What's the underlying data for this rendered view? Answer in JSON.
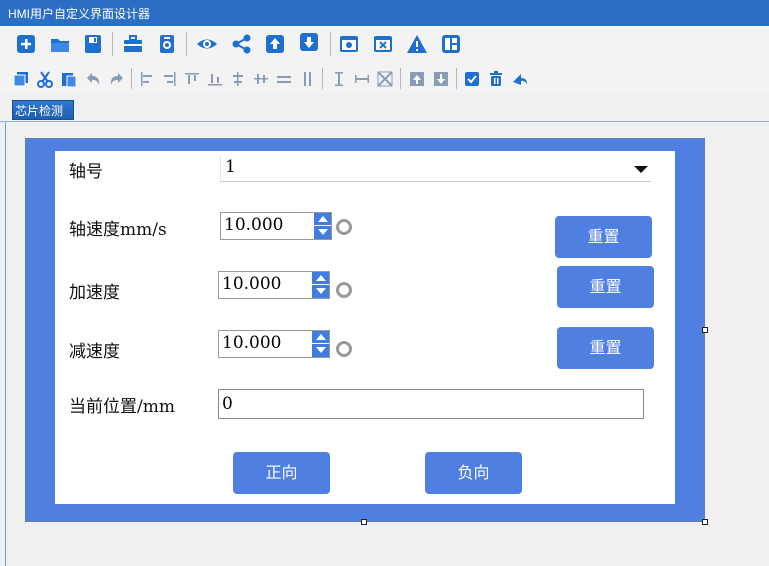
{
  "window": {
    "title": "HMI用户自定义界面设计器"
  },
  "toolbar1": {
    "icons": [
      "new-icon",
      "open-folder-icon",
      "save-icon",
      "toolbox-icon",
      "properties-icon",
      "preview-eye-icon",
      "share-icon",
      "upload-icon",
      "download-icon",
      "window-settings-icon",
      "window-close-icon",
      "warning-icon",
      "layout-icon"
    ]
  },
  "toolbar2": {
    "icons": [
      "copy-icon",
      "cut-icon",
      "paste-icon",
      "undo-icon",
      "redo-icon",
      "align-left-icon",
      "align-right-icon",
      "align-top-icon",
      "align-bottom-icon",
      "align-center-h-icon",
      "align-center-v-icon",
      "distribute-h-icon",
      "distribute-v-icon",
      "same-height-icon",
      "same-width-icon",
      "same-size-icon",
      "bring-front-icon",
      "send-back-icon",
      "check-icon",
      "delete-icon",
      "export-icon"
    ]
  },
  "tabs": [
    {
      "label": "芯片检测",
      "active": true
    }
  ],
  "form": {
    "axis": {
      "label": "轴号",
      "value": "1"
    },
    "axis_speed": {
      "label": "轴速度mm/s",
      "value": "10.000",
      "reset": "重置"
    },
    "acceleration": {
      "label": "加速度",
      "value": "10.000",
      "reset": "重置"
    },
    "deceleration": {
      "label": "减速度",
      "value": "10.000",
      "reset": "重置"
    },
    "current_position": {
      "label": "当前位置/mm",
      "value": "0"
    },
    "forward_button": "正向",
    "reverse_button": "负向"
  },
  "colors": {
    "accent": "#4f7fe0",
    "titlebar": "#2b6fc5",
    "toolbar_icon": "#1e6fd0"
  }
}
